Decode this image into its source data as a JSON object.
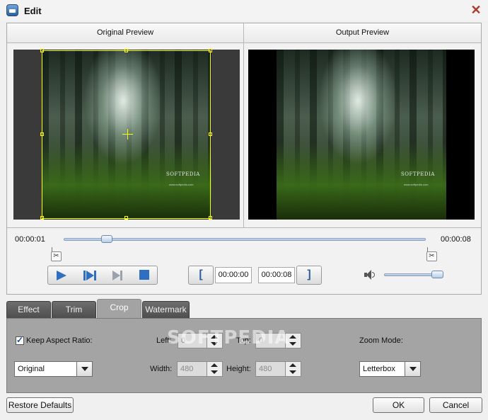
{
  "window": {
    "title": "Edit"
  },
  "preview": {
    "original_label": "Original Preview",
    "output_label": "Output Preview",
    "watermark_text": "SOFTPEDIA",
    "watermark_url": "www.softpedia.com"
  },
  "timeline": {
    "start_time": "00:00:01",
    "end_time": "00:00:08",
    "position_fraction": 0.12
  },
  "playback": {
    "icons": [
      "play-icon",
      "step-forward-icon",
      "next-frame-icon",
      "stop-icon"
    ],
    "trim_start": "00:00:00",
    "trim_end": "00:00:08",
    "set_start_glyph": "[",
    "set_end_glyph": "]",
    "volume_fraction": 0.95
  },
  "tabs": [
    "Effect",
    "Trim",
    "Crop",
    "Watermark"
  ],
  "active_tab": "Crop",
  "crop": {
    "keep_aspect_label": "Keep Aspect Ratio:",
    "keep_aspect_checked": true,
    "aspect_value": "Original",
    "left_label": "Left:",
    "left_value": "0",
    "top_label": "Top:",
    "top_value": "0",
    "width_label": "Width:",
    "width_value": "480",
    "height_label": "Height:",
    "height_value": "480",
    "zoom_label": "Zoom Mode:",
    "zoom_value": "Letterbox"
  },
  "overlay_watermark": "SOFTPEDIA",
  "buttons": {
    "restore": "Restore Defaults",
    "ok": "OK",
    "cancel": "Cancel"
  },
  "colors": {
    "accent": "#2f6fbf",
    "crop_frame": "#ffff00",
    "close": "#b03a2e"
  }
}
